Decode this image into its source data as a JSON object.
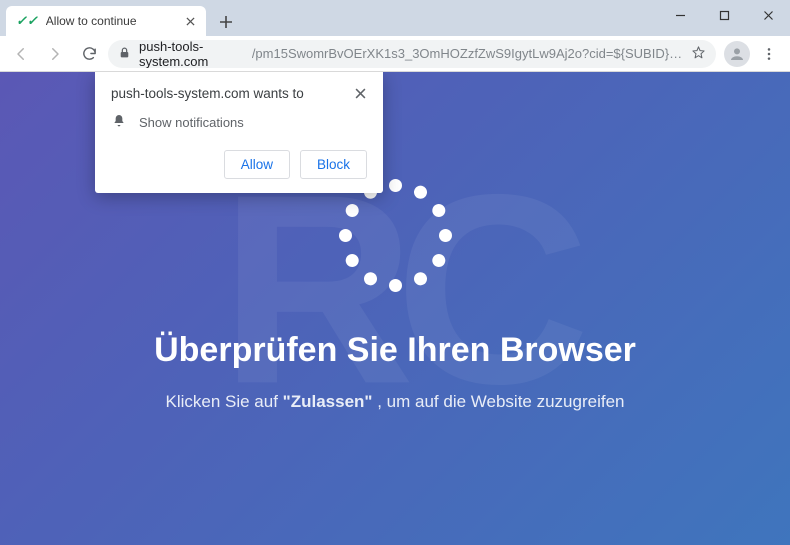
{
  "window": {
    "tab_title": "Allow to continue",
    "new_tab_tooltip": "New tab"
  },
  "toolbar": {
    "url_domain": "push-tools-system.com",
    "url_path": "/pm15SwomrBvOErXK1s3_3OmHOZzfZwS9IgytLw9Aj2o?cid=${SUBID}&subid={zonei..."
  },
  "permission": {
    "wants_to": "push-tools-system.com wants to",
    "show_notifications": "Show notifications",
    "allow": "Allow",
    "block": "Block"
  },
  "page": {
    "headline": "Überprüfen Sie Ihren Browser",
    "sub_prefix": "Klicken Sie auf ",
    "sub_bold": "\"Zulassen\"",
    "sub_suffix": " , um auf die Website zuzugreifen"
  },
  "watermark": "RC"
}
